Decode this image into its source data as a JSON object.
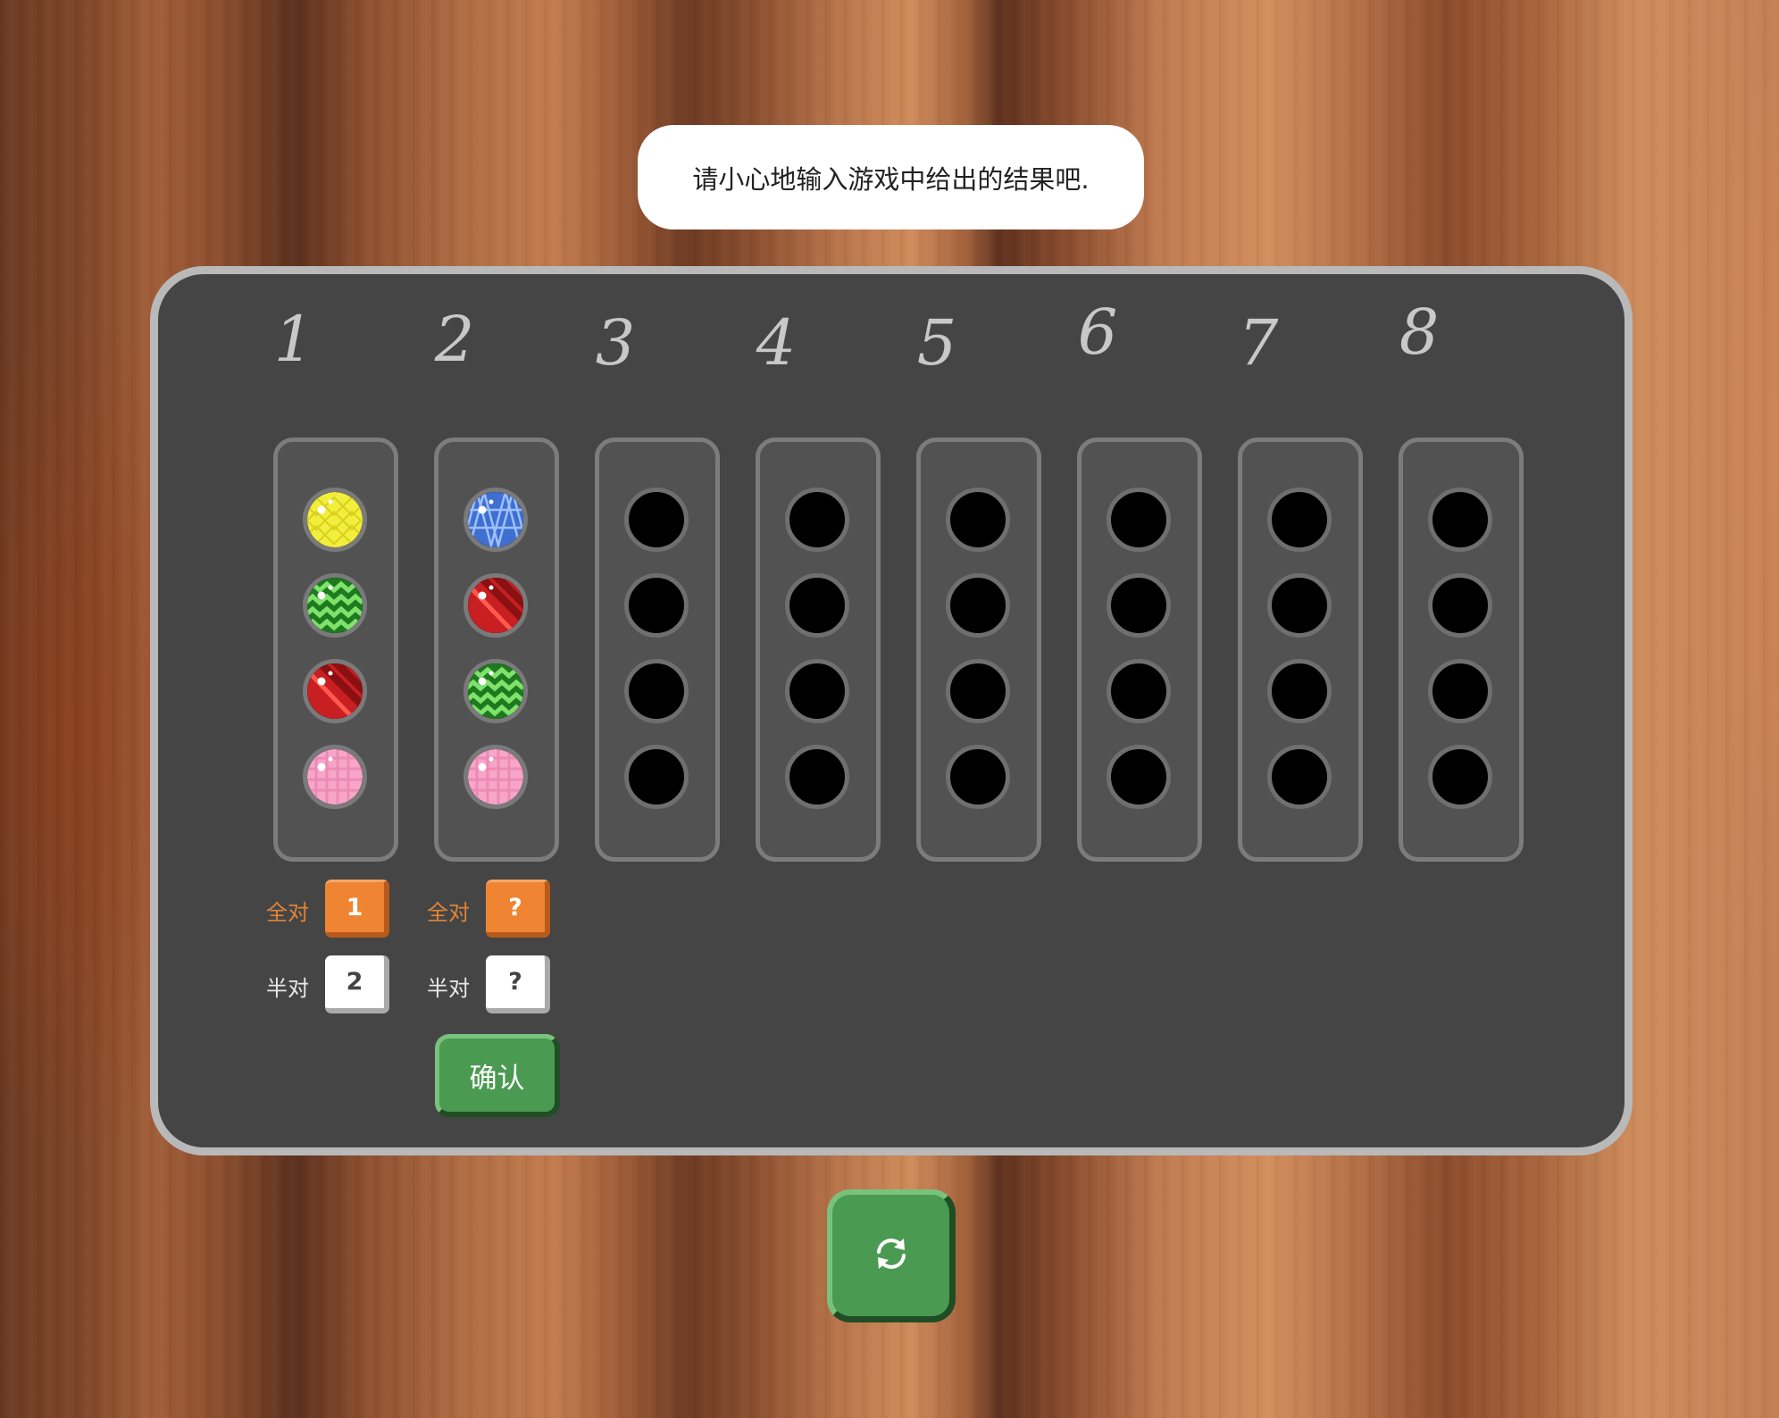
{
  "message": "请小心地输入游戏中给出的结果吧.",
  "columns": [
    {
      "number": "1",
      "pegs": [
        "yellow-diamond",
        "green-zigzag",
        "red-stripe",
        "pink-check"
      ],
      "exact_label": "全对",
      "exact_value": "1",
      "half_label": "半对",
      "half_value": "2"
    },
    {
      "number": "2",
      "pegs": [
        "blue-triangle",
        "red-stripe",
        "green-zigzag",
        "pink-check"
      ],
      "exact_label": "全对",
      "exact_value": "?",
      "half_label": "半对",
      "half_value": "?",
      "confirm_label": "确认"
    },
    {
      "number": "3",
      "pegs": [
        "empty",
        "empty",
        "empty",
        "empty"
      ]
    },
    {
      "number": "4",
      "pegs": [
        "empty",
        "empty",
        "empty",
        "empty"
      ]
    },
    {
      "number": "5",
      "pegs": [
        "empty",
        "empty",
        "empty",
        "empty"
      ]
    },
    {
      "number": "6",
      "pegs": [
        "empty",
        "empty",
        "empty",
        "empty"
      ]
    },
    {
      "number": "7",
      "pegs": [
        "empty",
        "empty",
        "empty",
        "empty"
      ]
    },
    {
      "number": "8",
      "pegs": [
        "empty",
        "empty",
        "empty",
        "empty"
      ]
    }
  ],
  "refresh_button": {
    "icon": "refresh-icon"
  },
  "colors": {
    "board": "#454545",
    "accent_orange": "#ef8433",
    "button_green": "#4b9a52",
    "peg_yellow": "#f2ee3c",
    "peg_green": "#3fae3a",
    "peg_red": "#d8282a",
    "peg_pink": "#f7a6c9",
    "peg_blue": "#3f6fd0"
  }
}
